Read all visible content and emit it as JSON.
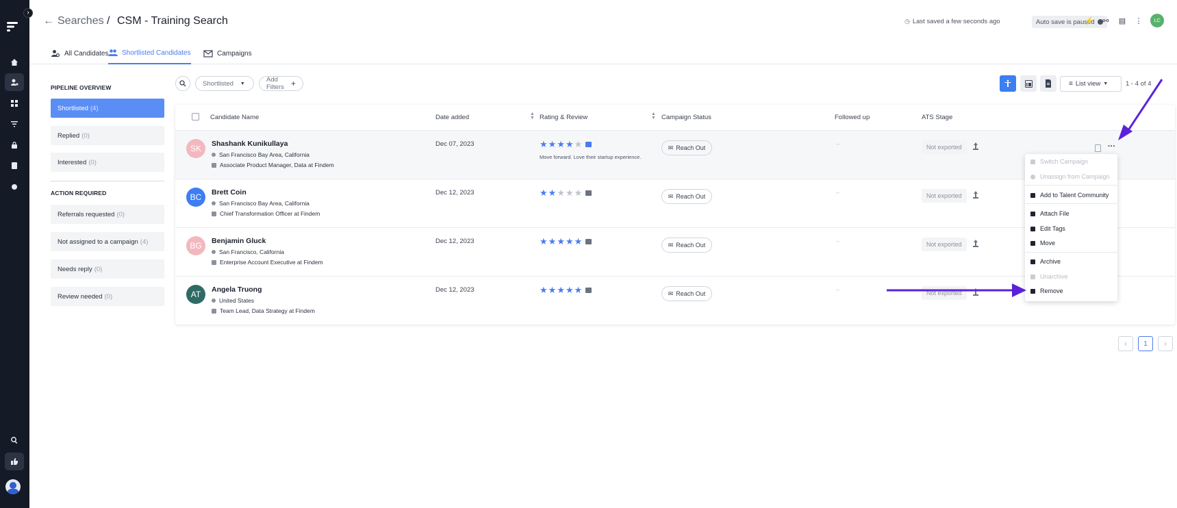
{
  "header": {
    "breadcrumb_root": "Searches",
    "breadcrumb_sep": "/",
    "title": "CSM - Training Search",
    "last_saved": "Last saved a few seconds ago",
    "autosave": "Auto save is paused",
    "user_initials": "LC"
  },
  "tabs": [
    {
      "label": "All Candidates"
    },
    {
      "label": "Shortlisted Candidates"
    },
    {
      "label": "Campaigns"
    }
  ],
  "pipeline": {
    "overview_title": "PIPELINE OVERVIEW",
    "action_title": "ACTION REQUIRED",
    "overview_items": [
      {
        "label": "Shortlisted",
        "count": "(4)"
      },
      {
        "label": "Replied",
        "count": "(0)"
      },
      {
        "label": "Interested",
        "count": "(0)"
      }
    ],
    "action_items": [
      {
        "label": "Referrals requested",
        "count": "(0)"
      },
      {
        "label": "Not assigned to a campaign",
        "count": "(4)"
      },
      {
        "label": "Needs reply",
        "count": "(0)"
      },
      {
        "label": "Review needed",
        "count": "(0)"
      }
    ]
  },
  "toolbar": {
    "filter_value": "Shortlisted",
    "add_filters": "Add Filters",
    "view_label": "List view",
    "range": "1 - 4 of 4"
  },
  "table": {
    "columns": [
      "Candidate Name",
      "Date added",
      "Rating & Review",
      "Campaign Status",
      "Followed up",
      "ATS Stage"
    ],
    "rows": [
      {
        "initials": "SK",
        "avatar_color": "#f2b8be",
        "name": "Shashank Kunikullaya",
        "location": "San Francisco Bay Area, California",
        "role": "Associate Product Manager, Data at Findem",
        "date": "Dec 07, 2023",
        "rating": 4,
        "review": "Move forward. Love their startup experience.",
        "campaign": "Reach Out",
        "followed_up": "–",
        "ats": "Not exported"
      },
      {
        "initials": "BC",
        "avatar_color": "#3d7ef2",
        "name": "Brett Coin",
        "location": "San Francisco Bay Area, California",
        "role": "Chief Transformation Officer at Findem",
        "date": "Dec 12, 2023",
        "rating": 2,
        "review": "",
        "campaign": "Reach Out",
        "followed_up": "–",
        "ats": "Not exported"
      },
      {
        "initials": "BG",
        "avatar_color": "#f2b8be",
        "name": "Benjamin Gluck",
        "location": "San Francisco, California",
        "role": "Enterprise Account Executive at Findem",
        "date": "Dec 12, 2023",
        "rating": 5,
        "review": "",
        "campaign": "Reach Out",
        "followed_up": "–",
        "ats": "Not exported"
      },
      {
        "initials": "AT",
        "avatar_color": "#2f6b64",
        "name": "Angela Truong",
        "location": "United States",
        "role": "Team Lead, Data Strategy at Findem",
        "date": "Dec 12, 2023",
        "rating": 5,
        "review": "",
        "campaign": "Reach Out",
        "followed_up": "–",
        "ats": "Not exported"
      }
    ]
  },
  "context_menu": {
    "items": [
      {
        "label": "Switch Campaign",
        "disabled": true
      },
      {
        "label": "Unassign from Campaign",
        "disabled": true
      },
      {
        "label": "Add to Talent Community",
        "disabled": false
      },
      {
        "label": "Attach File",
        "disabled": false
      },
      {
        "label": "Edit Tags",
        "disabled": false
      },
      {
        "label": "Move",
        "disabled": false
      },
      {
        "label": "Archive",
        "disabled": false
      },
      {
        "label": "Unarchive",
        "disabled": true
      },
      {
        "label": "Remove",
        "disabled": false
      }
    ]
  },
  "pagination": {
    "current": "1",
    "prev": "‹",
    "next": "›"
  },
  "colors": {
    "accent": "#4a7cf0",
    "sidebar": "#141a26",
    "annotation_arrow": "#5b21d9"
  }
}
